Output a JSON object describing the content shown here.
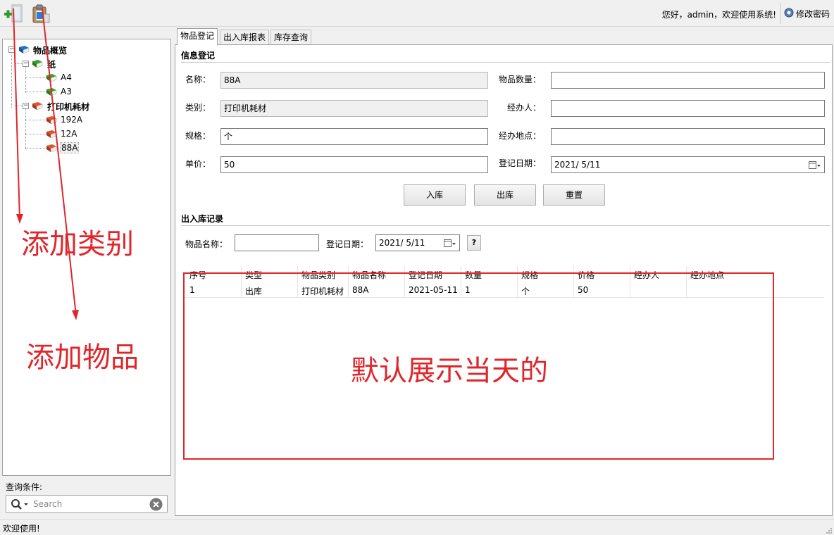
{
  "toolbar": {
    "add_category_icon": "add-category-icon",
    "add_item_icon": "clipboard-add-icon",
    "greeting": "您好，admin，欢迎使用系统!",
    "change_password_label": "修改密码"
  },
  "tree": {
    "root": "物品概览",
    "categories": [
      {
        "label": "纸",
        "color": "#3aa12a",
        "items": [
          "A4",
          "A3"
        ]
      },
      {
        "label": "打印机耗材",
        "color": "#e2532a",
        "items": [
          "192A",
          "12A",
          "88A"
        ]
      }
    ],
    "root_color": "#1f6fc7"
  },
  "search": {
    "label": "查询条件:",
    "placeholder": "Search"
  },
  "tabs": [
    "物品登记",
    "出入库报表",
    "库存查询"
  ],
  "form": {
    "section_title": "信息登记",
    "name_label": "名称：",
    "name_value": "88A",
    "category_label": "类别：",
    "category_value": "打印机耗材",
    "spec_label": "规格：",
    "spec_value": "个",
    "price_label": "单价：",
    "price_value": "50",
    "qty_label": "物品数量：",
    "qty_value": "",
    "handler_label": "经办人：",
    "handler_value": "",
    "location_label": "经办地点：",
    "location_value": "",
    "date_label": "登记日期：",
    "date_value": "2021/  5/11",
    "btn_in": "入库",
    "btn_out": "出库",
    "btn_reset": "重置"
  },
  "records": {
    "section_title": "出入库记录",
    "name_label": "物品名称：",
    "name_value": "",
    "date_label": "登记日期：",
    "date_value": "2021/  5/11",
    "help_label": "?",
    "columns": [
      "序号",
      "类型",
      "物品类别",
      "物品名称",
      "登记日期",
      "数量",
      "规格",
      "价格",
      "经办人",
      "经办地点"
    ],
    "rows": [
      [
        "1",
        "出库",
        "打印机耗材",
        "88A",
        "2021-05-11",
        "1",
        "个",
        "50",
        "",
        ""
      ]
    ]
  },
  "annotations": {
    "add_category": "添加类别",
    "add_item": "添加物品",
    "default_today": "默认展示当天的",
    "color": "#e0262b"
  },
  "status": "欢迎使用!"
}
